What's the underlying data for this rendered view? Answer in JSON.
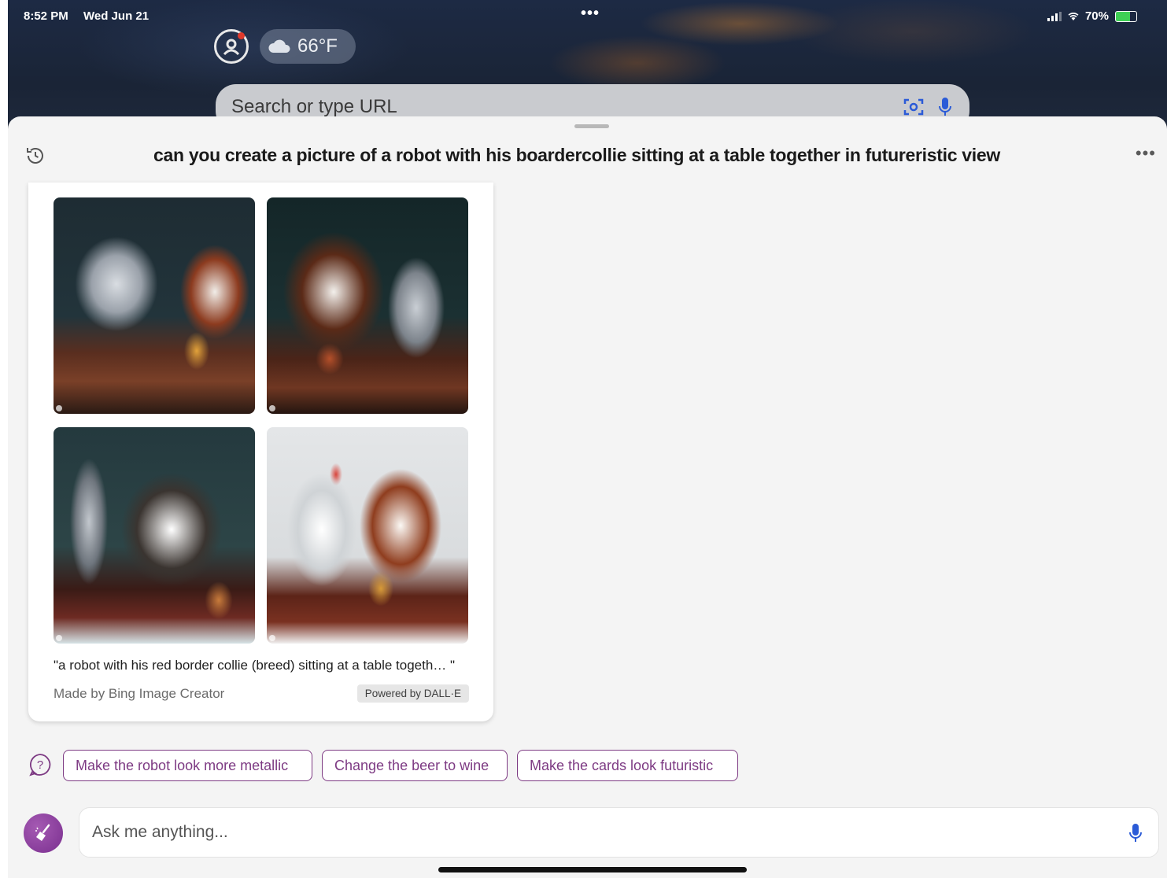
{
  "status_bar": {
    "time": "8:52 PM",
    "date": "Wed Jun 21",
    "battery": "70%"
  },
  "browser": {
    "weather": "66°F",
    "search_placeholder": "Search or type URL"
  },
  "chat": {
    "title": "can you create a picture of a robot with his boardercollie sitting at a table together in futureristic view",
    "result": {
      "images": [
        {
          "name": "generated-image-1"
        },
        {
          "name": "generated-image-2"
        },
        {
          "name": "generated-image-3"
        },
        {
          "name": "generated-image-4"
        }
      ],
      "caption": "\"a robot with his red border collie (breed) sitting at a table togeth… \"",
      "made_by": "Made by Bing Image Creator",
      "powered_by": "Powered by DALL·E"
    },
    "suggestions": [
      "Make the robot look more metallic",
      "Change the beer to wine",
      "Make the cards look futuristic"
    ],
    "input_placeholder": "Ask me anything..."
  },
  "colors": {
    "accent": "#7d3a83",
    "sheet_background": "#f4f4f4"
  },
  "icons": [
    "history-icon",
    "more-icon",
    "help-icon",
    "broom-icon",
    "mic-icon",
    "scan-icon",
    "profile-icon",
    "cloud-icon"
  ]
}
